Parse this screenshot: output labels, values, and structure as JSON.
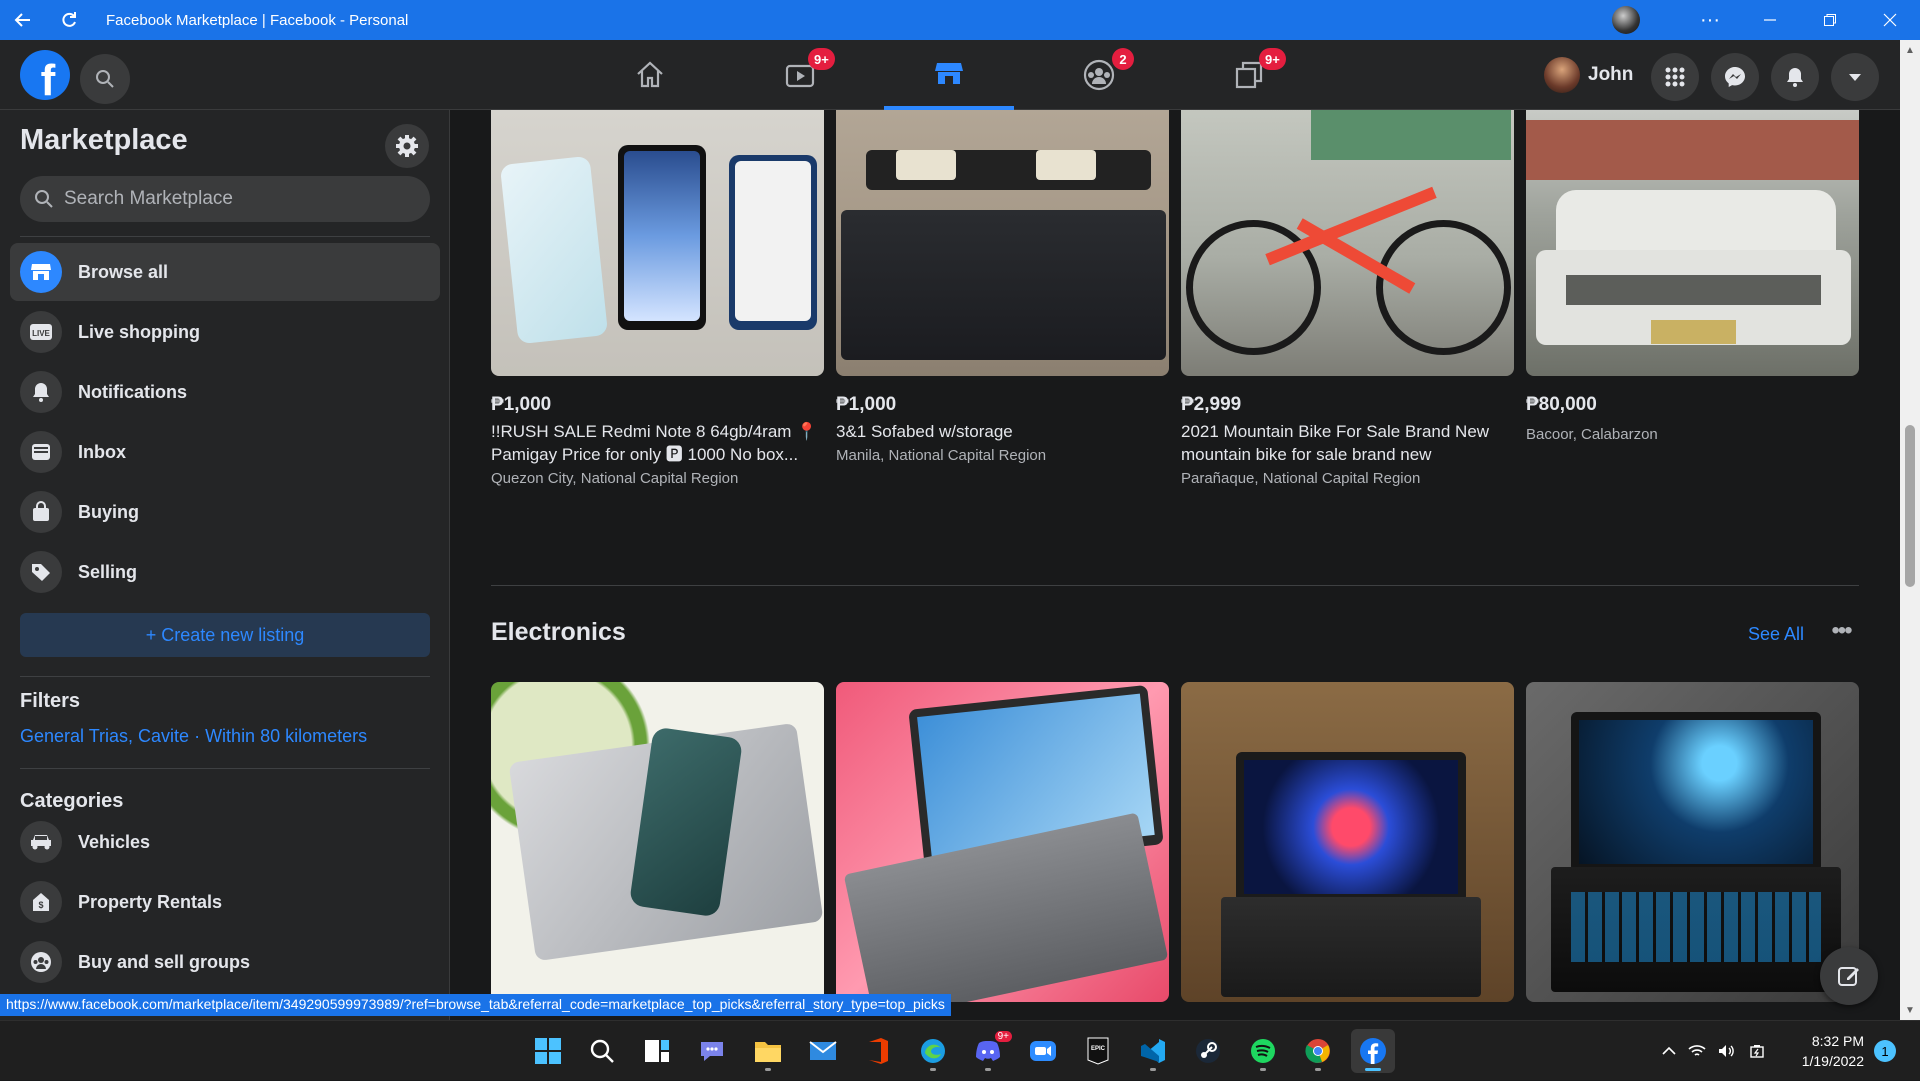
{
  "window": {
    "title": "Facebook Marketplace | Facebook - Personal",
    "accent": "#1a73e8"
  },
  "header": {
    "nav": [
      {
        "name": "home-icon",
        "badge": ""
      },
      {
        "name": "watch-icon",
        "badge": "9+"
      },
      {
        "name": "marketplace-icon",
        "badge": ""
      },
      {
        "name": "groups-icon",
        "badge": "2"
      },
      {
        "name": "gaming-icon",
        "badge": "9+"
      }
    ],
    "profile_name": "John"
  },
  "sidebar": {
    "title": "Marketplace",
    "search_placeholder": "Search Marketplace",
    "items": [
      {
        "label": "Browse all",
        "icon": "shop-icon"
      },
      {
        "label": "Live shopping",
        "icon": "live-icon"
      },
      {
        "label": "Notifications",
        "icon": "bell-icon"
      },
      {
        "label": "Inbox",
        "icon": "inbox-icon"
      },
      {
        "label": "Buying",
        "icon": "bag-icon"
      },
      {
        "label": "Selling",
        "icon": "tag-icon"
      }
    ],
    "create_label": "+ Create new listing",
    "filters_title": "Filters",
    "filter_location": "General Trias, Cavite · Within 80 kilometers",
    "categories_title": "Categories",
    "categories": [
      {
        "label": "Vehicles",
        "icon": "car-icon"
      },
      {
        "label": "Property Rentals",
        "icon": "house-icon"
      },
      {
        "label": "Buy and sell groups",
        "icon": "groups-icon"
      }
    ]
  },
  "listings": [
    {
      "price": "₱1,000",
      "title_line1": "!!RUSH SALE Redmi Note 8 64gb/4ram 📍",
      "title_line2": "Pamigay Price for only 🅿 1000 No box...",
      "location": "Quezon City, National Capital Region"
    },
    {
      "price": "₱1,000",
      "title_line1": "3&1 Sofabed w/storage",
      "title_line2": "",
      "location": "Manila, National Capital Region"
    },
    {
      "price": "₱2,999",
      "title_line1": "2021 Mountain Bike For Sale Brand New",
      "title_line2": "mountain bike for sale brand new",
      "location": "Parañaque, National Capital Region"
    },
    {
      "price": "₱80,000",
      "title_line1": "",
      "title_line2": "",
      "location": "Bacoor, Calabarzon"
    }
  ],
  "electronics": {
    "title": "Electronics",
    "see_all": "See All",
    "more": "•••"
  },
  "status_url": "https://www.facebook.com/marketplace/item/349290599973989/?ref=browse_tab&referral_code=marketplace_top_picks&referral_story_type=top_picks",
  "taskbar": {
    "discord_badge": "9+",
    "time": "8:32 PM",
    "date": "1/19/2022",
    "notifications": "1"
  }
}
